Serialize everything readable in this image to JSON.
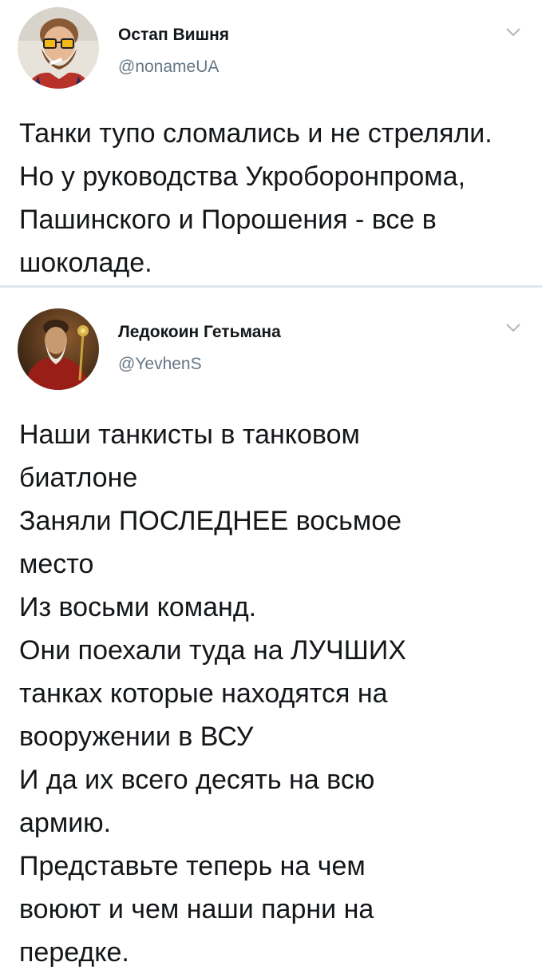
{
  "tweets": [
    {
      "author_name": "Остап Вишня",
      "author_handle": "@nonameUA",
      "text": "Танки тупо сломались и не стреляли. Но у руководства Укроборонпрома, Пашинского и Порошения - все в шоколаде.",
      "avatar_icon": "avatar-bearded-man-icon",
      "menu_icon": "chevron-down-icon"
    },
    {
      "author_name": "Ледокоин Гетьмана",
      "author_handle": "@YevhenS",
      "text": "Наши танкисты в танковом\nбиатлоне\nЗаняли ПОСЛЕДНЕЕ восьмое\nместо\nИз восьми команд.\nОни поехали туда на ЛУЧШИХ\nтанках которые находятся на\nвооружении в ВСУ\nИ да их всего десять на всю\nармию.\nПредставьте теперь на чем\nвоюют и чем наши парни на\nпередке.",
      "avatar_icon": "avatar-hetman-portrait-icon",
      "menu_icon": "chevron-down-icon"
    }
  ],
  "colors": {
    "text": "#14171a",
    "handle": "#657786",
    "divider": "#e1e8ed",
    "chevron": "#aab8c2"
  }
}
